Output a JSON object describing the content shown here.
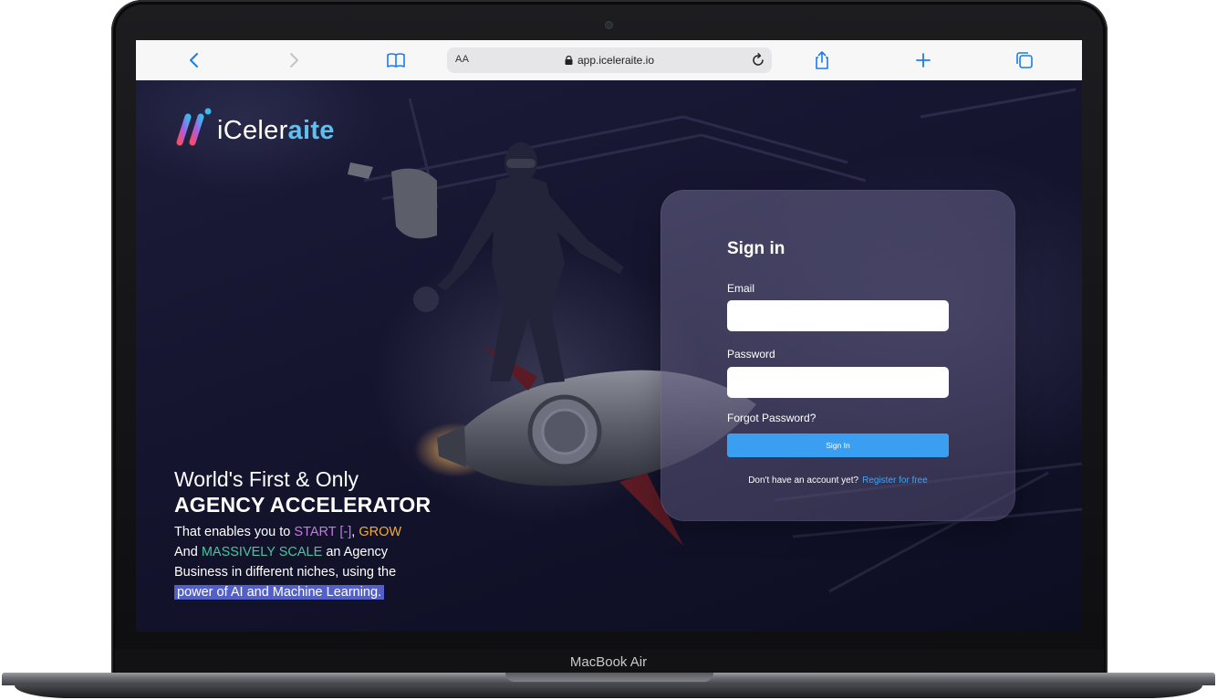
{
  "device": {
    "model_label": "MacBook Air"
  },
  "browser": {
    "aa_label": "AA",
    "url": "app.iceleraite.io",
    "icons": [
      "back-icon",
      "forward-icon",
      "bookmarks-icon",
      "lock-icon",
      "reload-icon",
      "share-icon",
      "new-tab-icon",
      "tabs-icon"
    ]
  },
  "brand": {
    "logo_part1": "iCeler",
    "logo_part2": "aite",
    "accent_color": "#5fc0ee"
  },
  "hero": {
    "line1": "World's First & Only",
    "line2": "AGENCY ACCELERATOR",
    "desc_prefix": "That enables you to ",
    "start": "START [-]",
    "comma": ", ",
    "grow": "GROW",
    "and": "And ",
    "massively": "MASSIVELY SCALE",
    "mid": " an Agency Business in different niches, using the",
    "highlight": "power of AI and Machine Learning."
  },
  "signin": {
    "title": "Sign in",
    "email_label": "Email",
    "email_value": "",
    "password_label": "Password",
    "password_value": "",
    "forgot": "Forgot Password?",
    "button": "Sign In",
    "no_account": "Don't have an account yet?",
    "register": "Register for free",
    "button_color": "#3a9ff0",
    "link_color": "#43a4f2"
  }
}
